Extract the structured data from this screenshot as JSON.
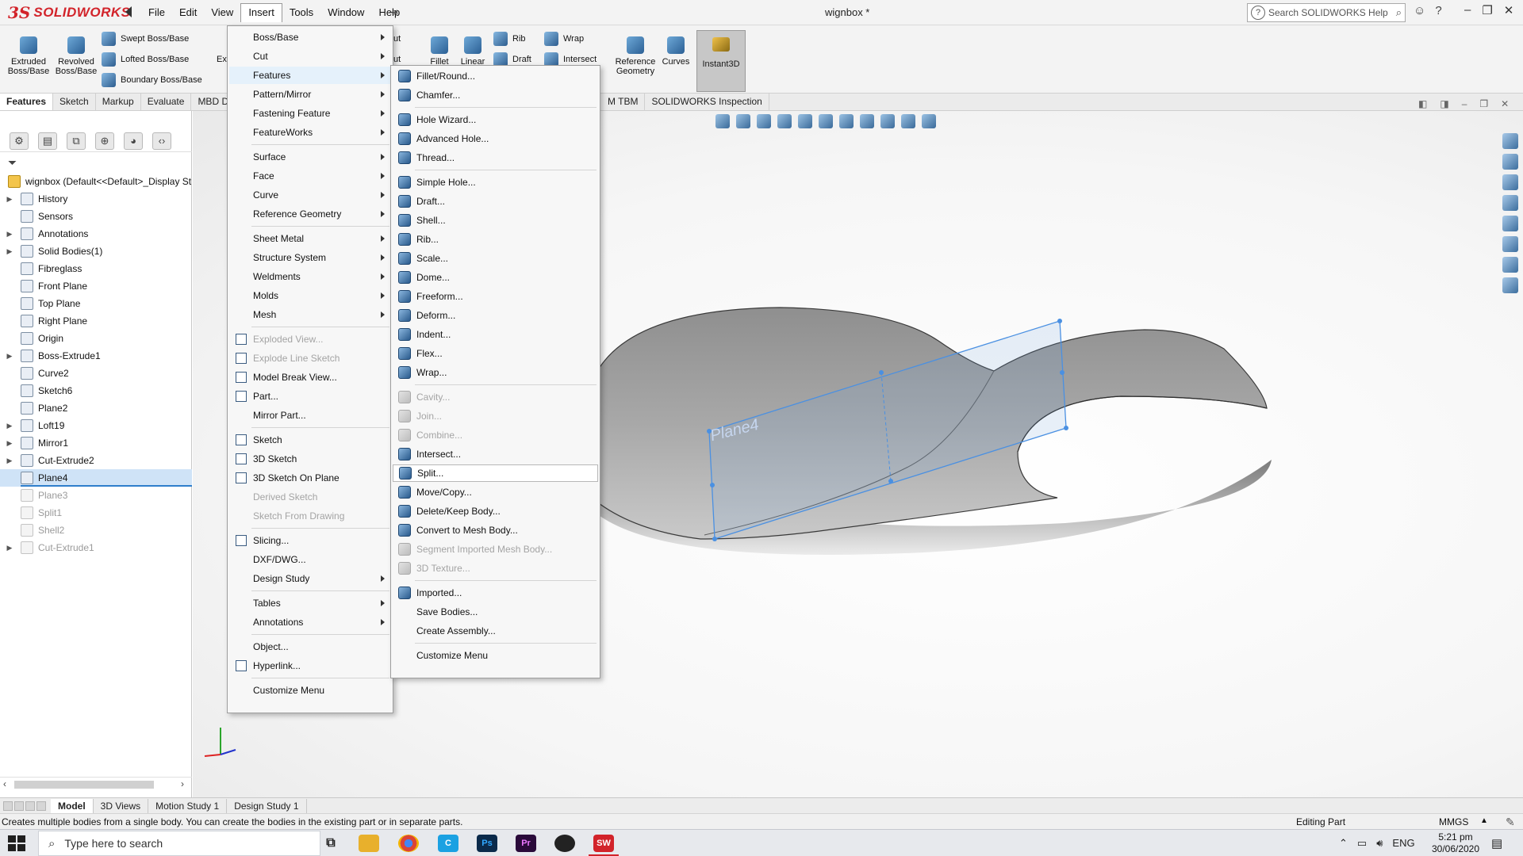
{
  "app": {
    "logo_ds": "3S",
    "logo_text": "SOLIDWORKS",
    "doc_title": "wignbox *",
    "menu": [
      "File",
      "Edit",
      "View",
      "Insert",
      "Tools",
      "Window",
      "Help"
    ],
    "active_menu": "Insert",
    "search_placeholder": "Search SOLIDWORKS Help"
  },
  "command_manager": {
    "extruded": "Extruded\nBoss/Base",
    "revolved": "Revolved\nBoss/Base",
    "swept": "Swept Boss/Base",
    "lofted": "Lofted Boss/Base",
    "boundary": "Boundary Boss/Base",
    "ex_partial": "Ex",
    "cut_partial_1": "ut",
    "cut_partial_2": "ut",
    "fillet": "Fillet",
    "linear": "Linear",
    "rib": "Rib",
    "wrap": "Wrap",
    "draft": "Draft",
    "intersect": "Intersect",
    "reference_geometry": "Reference\nGeometry",
    "curves": "Curves",
    "instant3d": "Instant3D"
  },
  "tabs": {
    "left": [
      "Features",
      "Sketch",
      "Markup",
      "Evaluate",
      "MBD Di"
    ],
    "active": "Features",
    "right": [
      "M TBM",
      "SOLIDWORKS Inspection"
    ]
  },
  "tree": {
    "root": "wignbox  (Default<<Default>_Display St",
    "items": [
      {
        "label": "History",
        "expandable": true,
        "state": "normal"
      },
      {
        "label": "Sensors",
        "expandable": false,
        "state": "normal"
      },
      {
        "label": "Annotations",
        "expandable": true,
        "state": "normal"
      },
      {
        "label": "Solid Bodies(1)",
        "expandable": true,
        "state": "normal"
      },
      {
        "label": "Fibreglass",
        "expandable": false,
        "state": "normal"
      },
      {
        "label": "Front Plane",
        "expandable": false,
        "state": "normal"
      },
      {
        "label": "Top Plane",
        "expandable": false,
        "state": "normal"
      },
      {
        "label": "Right Plane",
        "expandable": false,
        "state": "normal"
      },
      {
        "label": "Origin",
        "expandable": false,
        "state": "normal"
      },
      {
        "label": "Boss-Extrude1",
        "expandable": true,
        "state": "normal"
      },
      {
        "label": "Curve2",
        "expandable": false,
        "state": "normal"
      },
      {
        "label": "Sketch6",
        "expandable": false,
        "state": "normal"
      },
      {
        "label": "Plane2",
        "expandable": false,
        "state": "normal"
      },
      {
        "label": "Loft19",
        "expandable": true,
        "state": "normal"
      },
      {
        "label": "Mirror1",
        "expandable": true,
        "state": "normal"
      },
      {
        "label": "Cut-Extrude2",
        "expandable": true,
        "state": "normal"
      },
      {
        "label": "Plane4",
        "expandable": false,
        "state": "selected"
      },
      {
        "label": "Plane3",
        "expandable": false,
        "state": "dim"
      },
      {
        "label": "Split1",
        "expandable": false,
        "state": "dim"
      },
      {
        "label": "Shell2",
        "expandable": false,
        "state": "dim"
      },
      {
        "label": "Cut-Extrude1",
        "expandable": true,
        "state": "dim"
      }
    ]
  },
  "insert_menu": {
    "items": [
      {
        "label": "Boss/Base",
        "submenu": true
      },
      {
        "label": "Cut",
        "submenu": true
      },
      {
        "label": "Features",
        "submenu": true,
        "state": "highlight"
      },
      {
        "label": "Pattern/Mirror",
        "submenu": true
      },
      {
        "label": "Fastening Feature",
        "submenu": true
      },
      {
        "label": "FeatureWorks",
        "submenu": true
      },
      {
        "sep": true
      },
      {
        "label": "Surface",
        "submenu": true
      },
      {
        "label": "Face",
        "submenu": true
      },
      {
        "label": "Curve",
        "submenu": true
      },
      {
        "label": "Reference Geometry",
        "submenu": true
      },
      {
        "sep": true
      },
      {
        "label": "Sheet Metal",
        "submenu": true
      },
      {
        "label": "Structure System",
        "submenu": true
      },
      {
        "label": "Weldments",
        "submenu": true
      },
      {
        "label": "Molds",
        "submenu": true
      },
      {
        "label": "Mesh",
        "submenu": true
      },
      {
        "sep": true
      },
      {
        "label": "Exploded View...",
        "state": "disabled",
        "icon": "exploded-view-icon"
      },
      {
        "label": "Explode Line Sketch",
        "state": "disabled",
        "icon": "explode-line-icon"
      },
      {
        "label": "Model Break View...",
        "icon": "model-break-icon"
      },
      {
        "label": "Part...",
        "icon": "part-icon"
      },
      {
        "label": "Mirror Part..."
      },
      {
        "sep": true
      },
      {
        "label": "Sketch",
        "icon": "sketch-icon"
      },
      {
        "label": "3D Sketch",
        "icon": "3d-sketch-icon"
      },
      {
        "label": "3D Sketch On Plane",
        "icon": "3d-sketch-plane-icon"
      },
      {
        "label": "Derived Sketch",
        "state": "disabled"
      },
      {
        "label": "Sketch From Drawing",
        "state": "disabled"
      },
      {
        "sep": true
      },
      {
        "label": "Slicing...",
        "icon": "slicing-icon"
      },
      {
        "label": "DXF/DWG..."
      },
      {
        "label": "Design Study",
        "submenu": true
      },
      {
        "sep": true
      },
      {
        "label": "Tables",
        "submenu": true
      },
      {
        "label": "Annotations",
        "submenu": true
      },
      {
        "sep": true
      },
      {
        "label": "Object..."
      },
      {
        "label": "Hyperlink...",
        "icon": "hyperlink-icon"
      },
      {
        "sep": true
      },
      {
        "label": "Customize Menu"
      }
    ]
  },
  "features_menu": {
    "items": [
      {
        "label": "Fillet/Round...",
        "icon": "fillet-icon"
      },
      {
        "label": "Chamfer...",
        "icon": "chamfer-icon"
      },
      {
        "sep": true
      },
      {
        "label": "Hole Wizard...",
        "icon": "hole-wizard-icon"
      },
      {
        "label": "Advanced Hole...",
        "icon": "advanced-hole-icon"
      },
      {
        "label": "Thread...",
        "icon": "thread-icon"
      },
      {
        "sep": true
      },
      {
        "label": "Simple Hole...",
        "icon": "simple-hole-icon"
      },
      {
        "label": "Draft...",
        "icon": "draft-icon"
      },
      {
        "label": "Shell...",
        "icon": "shell-icon"
      },
      {
        "label": "Rib...",
        "icon": "rib-icon"
      },
      {
        "label": "Scale...",
        "icon": "scale-icon"
      },
      {
        "label": "Dome...",
        "icon": "dome-icon"
      },
      {
        "label": "Freeform...",
        "icon": "freeform-icon"
      },
      {
        "label": "Deform...",
        "icon": "deform-icon"
      },
      {
        "label": "Indent...",
        "icon": "indent-icon"
      },
      {
        "label": "Flex...",
        "icon": "flex-icon"
      },
      {
        "label": "Wrap...",
        "icon": "wrap-icon"
      },
      {
        "sep": true
      },
      {
        "label": "Cavity...",
        "icon": "cavity-icon",
        "state": "disabled"
      },
      {
        "label": "Join...",
        "icon": "join-icon",
        "state": "disabled"
      },
      {
        "label": "Combine...",
        "icon": "combine-icon",
        "state": "disabled"
      },
      {
        "label": "Intersect...",
        "icon": "intersect-icon"
      },
      {
        "label": "Split...",
        "icon": "split-icon",
        "state": "hovered"
      },
      {
        "label": "Move/Copy...",
        "icon": "move-copy-icon"
      },
      {
        "label": "Delete/Keep Body...",
        "icon": "delete-keep-body-icon"
      },
      {
        "label": "Convert to Mesh Body...",
        "icon": "convert-mesh-icon"
      },
      {
        "label": "Segment Imported Mesh Body...",
        "icon": "segment-mesh-icon",
        "state": "disabled"
      },
      {
        "label": "3D Texture...",
        "icon": "3d-texture-icon",
        "state": "disabled"
      },
      {
        "sep": true
      },
      {
        "label": "Imported...",
        "icon": "imported-icon"
      },
      {
        "label": "Save Bodies..."
      },
      {
        "label": "Create Assembly..."
      },
      {
        "sep": true
      },
      {
        "label": "Customize Menu"
      }
    ]
  },
  "viewport": {
    "plane_label": "Plane4"
  },
  "bottom_tabs": [
    "Model",
    "3D Views",
    "Motion Study 1",
    "Design Study 1"
  ],
  "bottom_active": "Model",
  "status": {
    "message": "Creates multiple bodies from a single body. You can create the bodies in the existing part or in separate parts.",
    "mode": "Editing Part",
    "units": "MMGS"
  },
  "taskbar": {
    "search_placeholder": "Type here to search",
    "lang": "ENG",
    "time": "5:21 pm",
    "date": "30/06/2020"
  },
  "colors": {
    "brand": "#d2232a",
    "selection": "#cfe3f7",
    "plane": "#4a90e2"
  }
}
